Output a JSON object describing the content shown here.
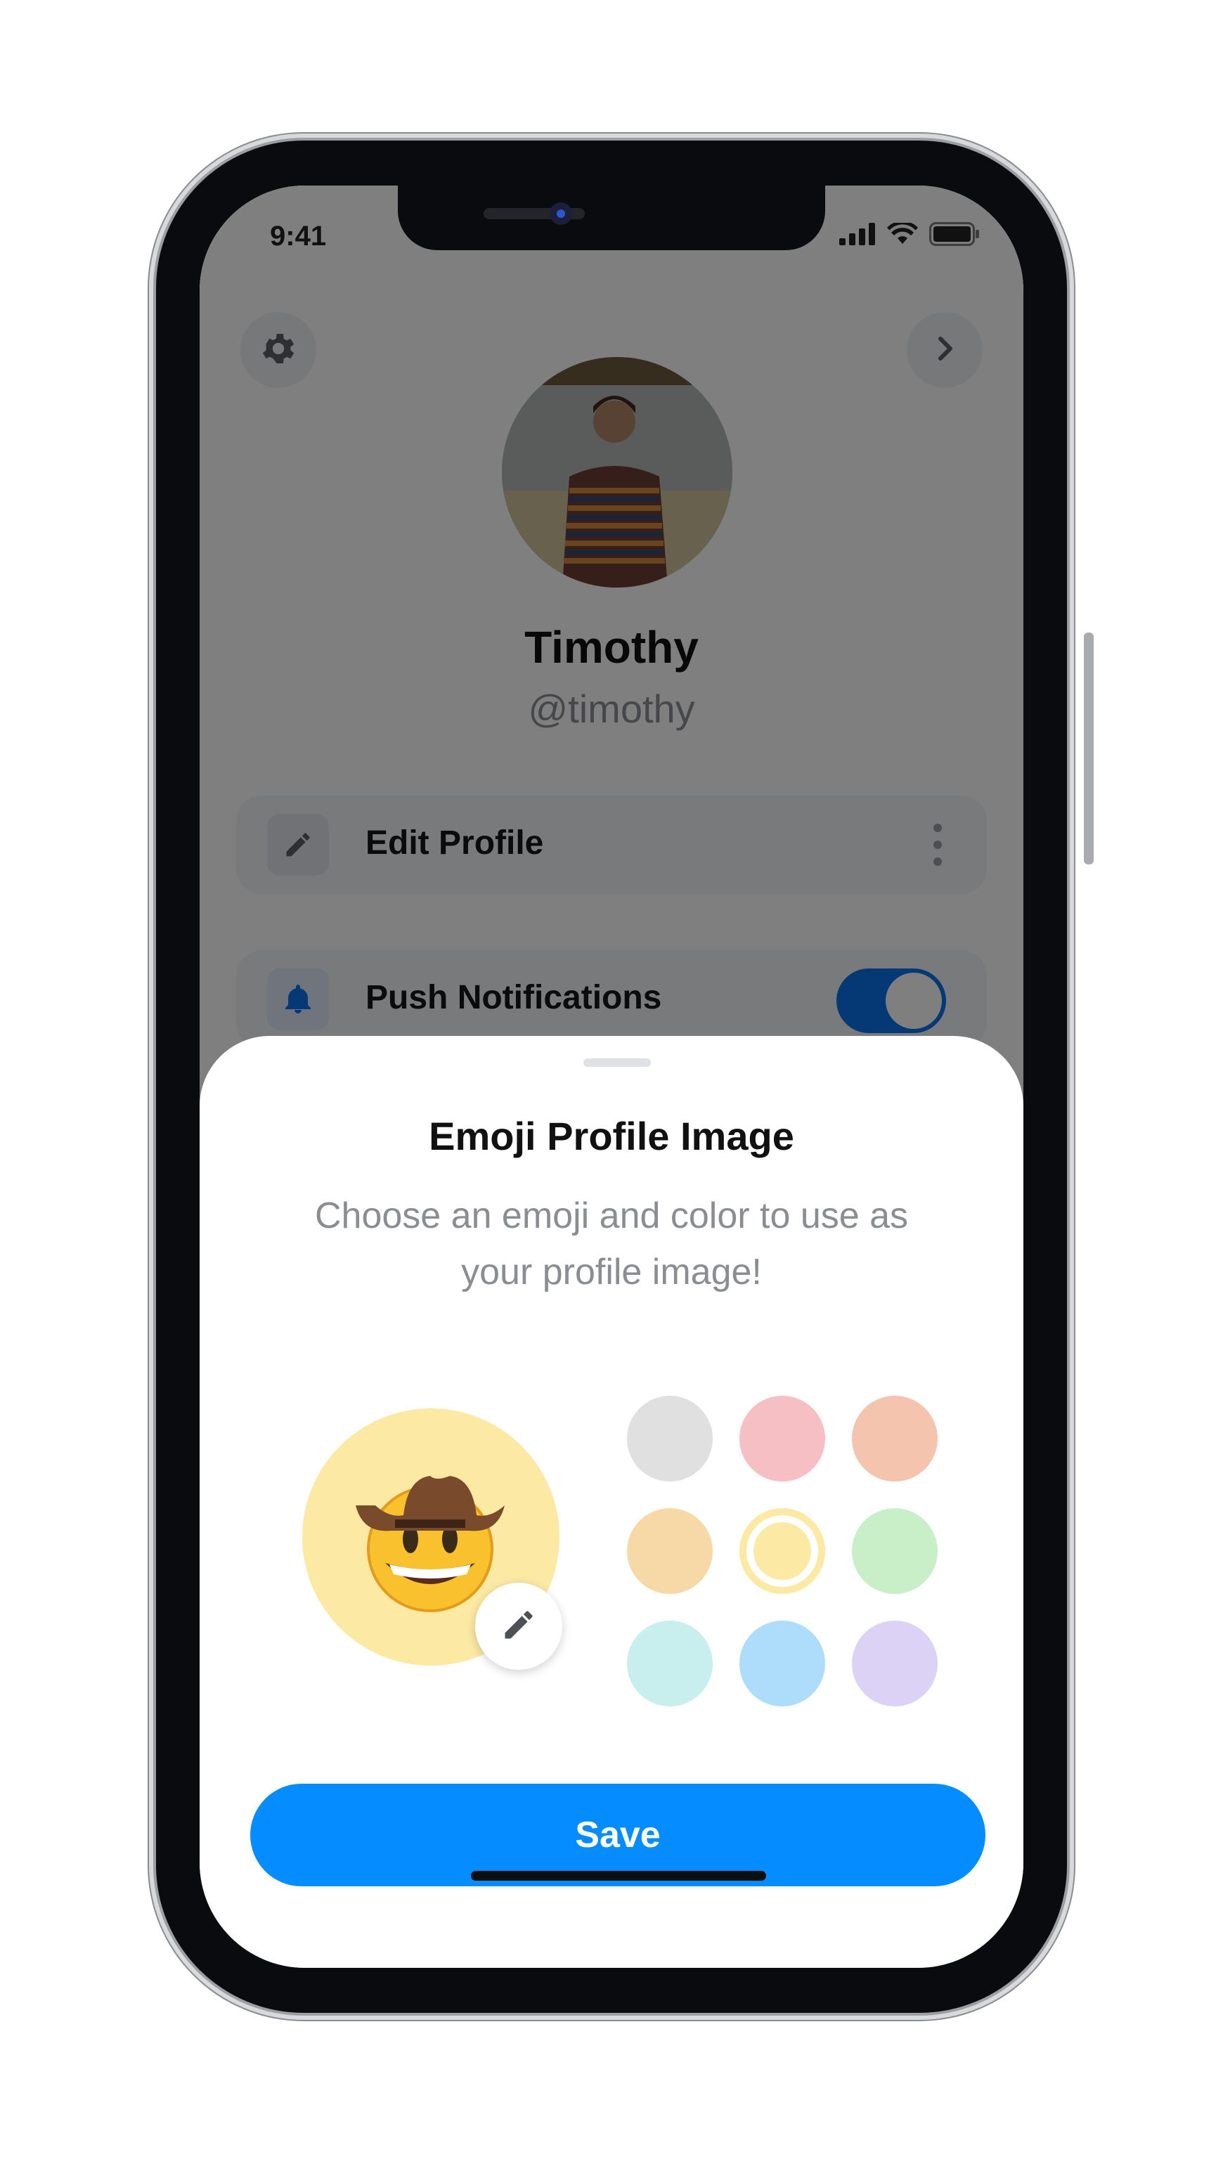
{
  "status_bar": {
    "time": "9:41"
  },
  "profile": {
    "name": "Timothy",
    "handle": "@timothy"
  },
  "settings": [
    {
      "label": "Edit Profile"
    },
    {
      "label": "Push Notifications",
      "enabled": true
    }
  ],
  "sheet": {
    "title": "Emoji Profile Image",
    "description": "Choose an emoji and color to use as your profile image!",
    "selected_emoji": "🤠",
    "selected_color": "#fbe9a4",
    "colors": [
      "#e0e0e0",
      "#f6bfc4",
      "#f4c4ae",
      "#f7d9a8",
      "#fbe9a4",
      "#c9efc8",
      "#c8eeee",
      "#aedcfb",
      "#dcd2f6"
    ],
    "save_label": "Save"
  },
  "accent": "#058cff"
}
